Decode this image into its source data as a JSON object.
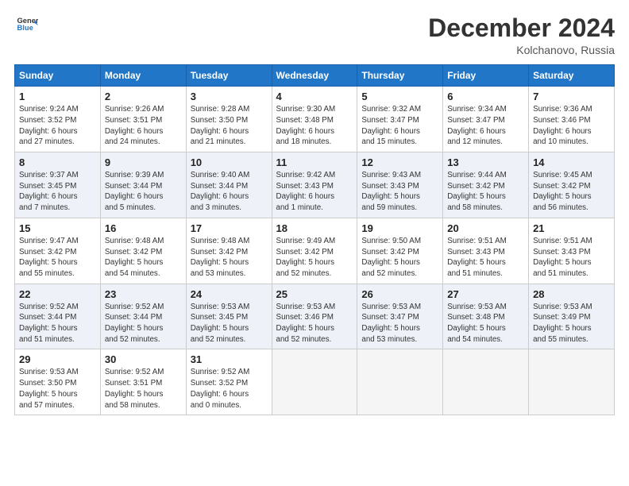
{
  "header": {
    "logo_line1": "General",
    "logo_line2": "Blue",
    "month_title": "December 2024",
    "location": "Kolchanovo, Russia"
  },
  "weekdays": [
    "Sunday",
    "Monday",
    "Tuesday",
    "Wednesday",
    "Thursday",
    "Friday",
    "Saturday"
  ],
  "weeks": [
    [
      {
        "day": 1,
        "info": "Sunrise: 9:24 AM\nSunset: 3:52 PM\nDaylight: 6 hours\nand 27 minutes."
      },
      {
        "day": 2,
        "info": "Sunrise: 9:26 AM\nSunset: 3:51 PM\nDaylight: 6 hours\nand 24 minutes."
      },
      {
        "day": 3,
        "info": "Sunrise: 9:28 AM\nSunset: 3:50 PM\nDaylight: 6 hours\nand 21 minutes."
      },
      {
        "day": 4,
        "info": "Sunrise: 9:30 AM\nSunset: 3:48 PM\nDaylight: 6 hours\nand 18 minutes."
      },
      {
        "day": 5,
        "info": "Sunrise: 9:32 AM\nSunset: 3:47 PM\nDaylight: 6 hours\nand 15 minutes."
      },
      {
        "day": 6,
        "info": "Sunrise: 9:34 AM\nSunset: 3:47 PM\nDaylight: 6 hours\nand 12 minutes."
      },
      {
        "day": 7,
        "info": "Sunrise: 9:36 AM\nSunset: 3:46 PM\nDaylight: 6 hours\nand 10 minutes."
      }
    ],
    [
      {
        "day": 8,
        "info": "Sunrise: 9:37 AM\nSunset: 3:45 PM\nDaylight: 6 hours\nand 7 minutes."
      },
      {
        "day": 9,
        "info": "Sunrise: 9:39 AM\nSunset: 3:44 PM\nDaylight: 6 hours\nand 5 minutes."
      },
      {
        "day": 10,
        "info": "Sunrise: 9:40 AM\nSunset: 3:44 PM\nDaylight: 6 hours\nand 3 minutes."
      },
      {
        "day": 11,
        "info": "Sunrise: 9:42 AM\nSunset: 3:43 PM\nDaylight: 6 hours\nand 1 minute."
      },
      {
        "day": 12,
        "info": "Sunrise: 9:43 AM\nSunset: 3:43 PM\nDaylight: 5 hours\nand 59 minutes."
      },
      {
        "day": 13,
        "info": "Sunrise: 9:44 AM\nSunset: 3:42 PM\nDaylight: 5 hours\nand 58 minutes."
      },
      {
        "day": 14,
        "info": "Sunrise: 9:45 AM\nSunset: 3:42 PM\nDaylight: 5 hours\nand 56 minutes."
      }
    ],
    [
      {
        "day": 15,
        "info": "Sunrise: 9:47 AM\nSunset: 3:42 PM\nDaylight: 5 hours\nand 55 minutes."
      },
      {
        "day": 16,
        "info": "Sunrise: 9:48 AM\nSunset: 3:42 PM\nDaylight: 5 hours\nand 54 minutes."
      },
      {
        "day": 17,
        "info": "Sunrise: 9:48 AM\nSunset: 3:42 PM\nDaylight: 5 hours\nand 53 minutes."
      },
      {
        "day": 18,
        "info": "Sunrise: 9:49 AM\nSunset: 3:42 PM\nDaylight: 5 hours\nand 52 minutes."
      },
      {
        "day": 19,
        "info": "Sunrise: 9:50 AM\nSunset: 3:42 PM\nDaylight: 5 hours\nand 52 minutes."
      },
      {
        "day": 20,
        "info": "Sunrise: 9:51 AM\nSunset: 3:43 PM\nDaylight: 5 hours\nand 51 minutes."
      },
      {
        "day": 21,
        "info": "Sunrise: 9:51 AM\nSunset: 3:43 PM\nDaylight: 5 hours\nand 51 minutes."
      }
    ],
    [
      {
        "day": 22,
        "info": "Sunrise: 9:52 AM\nSunset: 3:44 PM\nDaylight: 5 hours\nand 51 minutes."
      },
      {
        "day": 23,
        "info": "Sunrise: 9:52 AM\nSunset: 3:44 PM\nDaylight: 5 hours\nand 52 minutes."
      },
      {
        "day": 24,
        "info": "Sunrise: 9:53 AM\nSunset: 3:45 PM\nDaylight: 5 hours\nand 52 minutes."
      },
      {
        "day": 25,
        "info": "Sunrise: 9:53 AM\nSunset: 3:46 PM\nDaylight: 5 hours\nand 52 minutes."
      },
      {
        "day": 26,
        "info": "Sunrise: 9:53 AM\nSunset: 3:47 PM\nDaylight: 5 hours\nand 53 minutes."
      },
      {
        "day": 27,
        "info": "Sunrise: 9:53 AM\nSunset: 3:48 PM\nDaylight: 5 hours\nand 54 minutes."
      },
      {
        "day": 28,
        "info": "Sunrise: 9:53 AM\nSunset: 3:49 PM\nDaylight: 5 hours\nand 55 minutes."
      }
    ],
    [
      {
        "day": 29,
        "info": "Sunrise: 9:53 AM\nSunset: 3:50 PM\nDaylight: 5 hours\nand 57 minutes."
      },
      {
        "day": 30,
        "info": "Sunrise: 9:52 AM\nSunset: 3:51 PM\nDaylight: 5 hours\nand 58 minutes."
      },
      {
        "day": 31,
        "info": "Sunrise: 9:52 AM\nSunset: 3:52 PM\nDaylight: 6 hours\nand 0 minutes."
      },
      null,
      null,
      null,
      null
    ]
  ]
}
